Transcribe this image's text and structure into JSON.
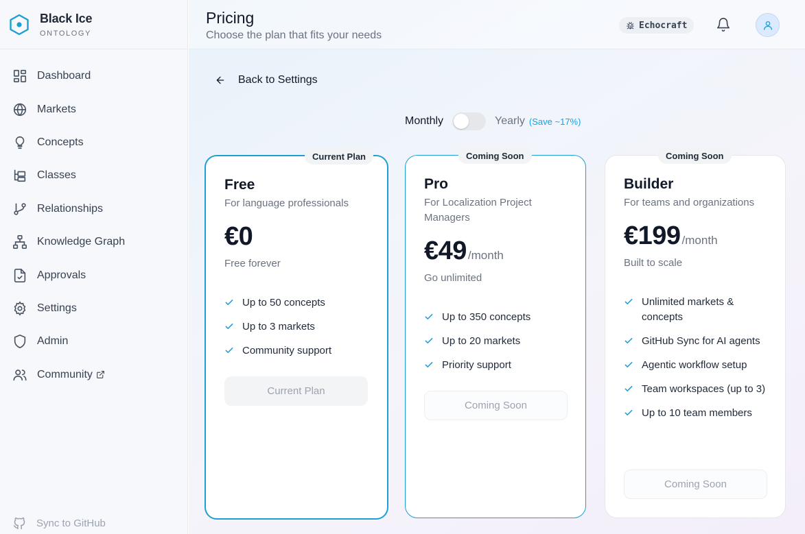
{
  "brand": {
    "title": "Black Ice",
    "subtitle": "ONTOLOGY",
    "accent": "#1e9fd3"
  },
  "sidebar": {
    "items": [
      {
        "label": "Dashboard",
        "icon": "dashboard-icon"
      },
      {
        "label": "Markets",
        "icon": "globe-icon"
      },
      {
        "label": "Concepts",
        "icon": "lightbulb-icon"
      },
      {
        "label": "Classes",
        "icon": "classes-tree-icon"
      },
      {
        "label": "Relationships",
        "icon": "git-branch-icon"
      },
      {
        "label": "Knowledge Graph",
        "icon": "network-icon"
      },
      {
        "label": "Approvals",
        "icon": "file-check-icon"
      },
      {
        "label": "Settings",
        "icon": "gear-icon"
      },
      {
        "label": "Admin",
        "icon": "shield-icon"
      },
      {
        "label": "Community",
        "icon": "users-icon",
        "external": true
      }
    ],
    "sync_label": "Sync to GitHub"
  },
  "header": {
    "title": "Pricing",
    "subtitle": "Choose the plan that fits your needs",
    "workspace": "Echocraft"
  },
  "back_label": "Back to Settings",
  "billing": {
    "monthly": "Monthly",
    "yearly": "Yearly",
    "save": "(Save ~17%)",
    "yearly_selected": false
  },
  "plans": [
    {
      "badge": "Current Plan",
      "name": "Free",
      "description": "For language professionals",
      "price": "€0",
      "period": "",
      "tagline": "Free forever",
      "features": [
        "Up to 50 concepts",
        "Up to 3 markets",
        "Community support"
      ],
      "cta": "Current Plan"
    },
    {
      "badge": "Coming Soon",
      "name": "Pro",
      "description": "For Localization Project Managers",
      "price": "€49",
      "period": "/month",
      "tagline": "Go unlimited",
      "features": [
        "Up to 350 concepts",
        "Up to 20 markets",
        "Priority support"
      ],
      "cta": "Coming Soon"
    },
    {
      "badge": "Coming Soon",
      "name": "Builder",
      "description": "For teams and organizations",
      "price": "€199",
      "period": "/month",
      "tagline": "Built to scale",
      "features": [
        "Unlimited markets & concepts",
        "GitHub Sync for AI agents",
        "Agentic workflow setup",
        "Team workspaces (up to 3)",
        "Up to 10 team members"
      ],
      "cta": "Coming Soon"
    }
  ]
}
